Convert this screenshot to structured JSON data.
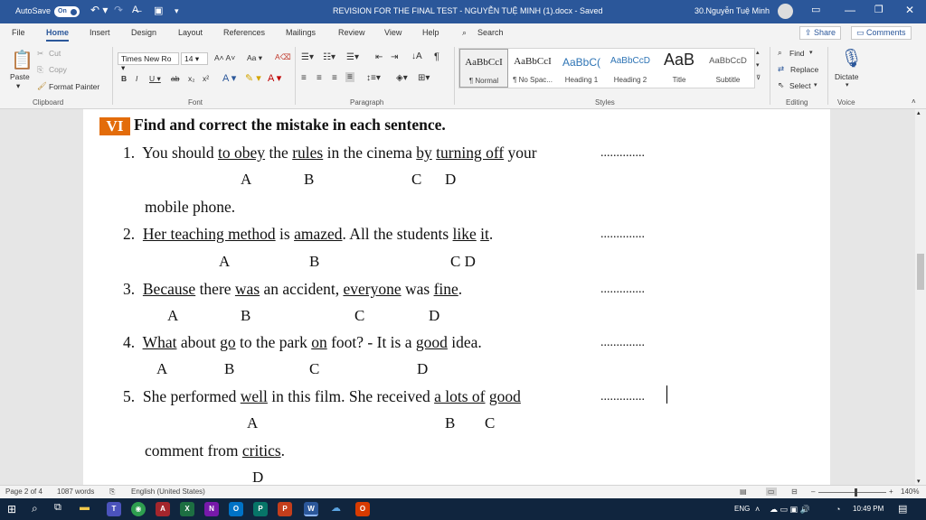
{
  "titlebar": {
    "autosave": "AutoSave",
    "toggle": "On",
    "doc_title": "REVISION FOR THE FINAL TEST - NGUYỄN TUỆ MINH (1).docx  -  Saved",
    "user": "30.Nguyễn Tuệ Minh"
  },
  "tabs": [
    "File",
    "Home",
    "Insert",
    "Design",
    "Layout",
    "References",
    "Mailings",
    "Review",
    "View",
    "Help"
  ],
  "search_placeholder": "Search",
  "share": "Share",
  "comments": "Comments",
  "clipboard": {
    "paste": "Paste",
    "cut": "Cut",
    "copy": "Copy",
    "format_painter": "Format Painter",
    "label": "Clipboard"
  },
  "font": {
    "name": "Times New Ro",
    "size": "14",
    "label": "Font"
  },
  "paragraph_label": "Paragraph",
  "styles": {
    "label": "Styles",
    "items": [
      {
        "preview": "AaBbCcI",
        "name": "¶ Normal"
      },
      {
        "preview": "AaBbCcI",
        "name": "¶ No Spac..."
      },
      {
        "preview": "AaBbC(",
        "name": "Heading 1"
      },
      {
        "preview": "AaBbCcD",
        "name": "Heading 2"
      },
      {
        "preview": "AaB",
        "name": "Title"
      },
      {
        "preview": "AaBbCcD",
        "name": "Subtitle"
      }
    ]
  },
  "editing": {
    "find": "Find",
    "replace": "Replace",
    "select": "Select",
    "label": "Editing"
  },
  "voice": {
    "dictate": "Dictate",
    "label": "Voice"
  },
  "document": {
    "section_num": "VI",
    "section_title": "Find and correct the mistake in each sentence.",
    "dots": "..............",
    "s1": {
      "n": "1.",
      "p1": "You should ",
      "u1": "to obey",
      "p2": " the ",
      "u2": "rules",
      "p3": " in the cinema ",
      "u3": "by",
      "p4": " ",
      "u4": "turning off",
      "p5": " your",
      "cont": "mobile phone."
    },
    "s2": {
      "n": "2.",
      "u1": "Her teaching method",
      "p1": " is ",
      "u2": "amazed",
      "p2": ". All the students ",
      "u3": "like",
      "p3": " ",
      "u4": "it",
      "p4": "."
    },
    "s3": {
      "n": "3.",
      "u1": "Because",
      "p1": " there ",
      "u2": "was",
      "p2": " an accident, ",
      "u3": "everyone",
      "p3": " was ",
      "u4": "fine",
      "p4": "."
    },
    "s4": {
      "n": "4.",
      "u1": "What",
      "p1": " about ",
      "u2": "go",
      "p2": " to the park ",
      "u3": "on",
      "p3": " foot? - It is a ",
      "u4": "good",
      "p4": " idea."
    },
    "s5": {
      "n": "5.",
      "p1": "She performed ",
      "u1": "well",
      "p2": " in this film. She received ",
      "u2": "a lots of",
      "p3": " ",
      "u3": "good",
      "p4": "",
      "cont1": "comment from ",
      "u4": "critics",
      "cont2": "."
    },
    "letters": {
      "A": "A",
      "B": "B",
      "C": "C",
      "D": "D",
      "CD": "C D"
    }
  },
  "status": {
    "page": "Page 2 of 4",
    "words": "1087 words",
    "language": "English (United States)",
    "zoom": "140%",
    "zoom_level": 0.56
  },
  "taskbar": {
    "lang": "ENG",
    "time": "10:49 PM"
  },
  "colors": {
    "word_blue": "#2b579a",
    "section_orange": "#e36c0a",
    "taskbar": "#10253e"
  }
}
